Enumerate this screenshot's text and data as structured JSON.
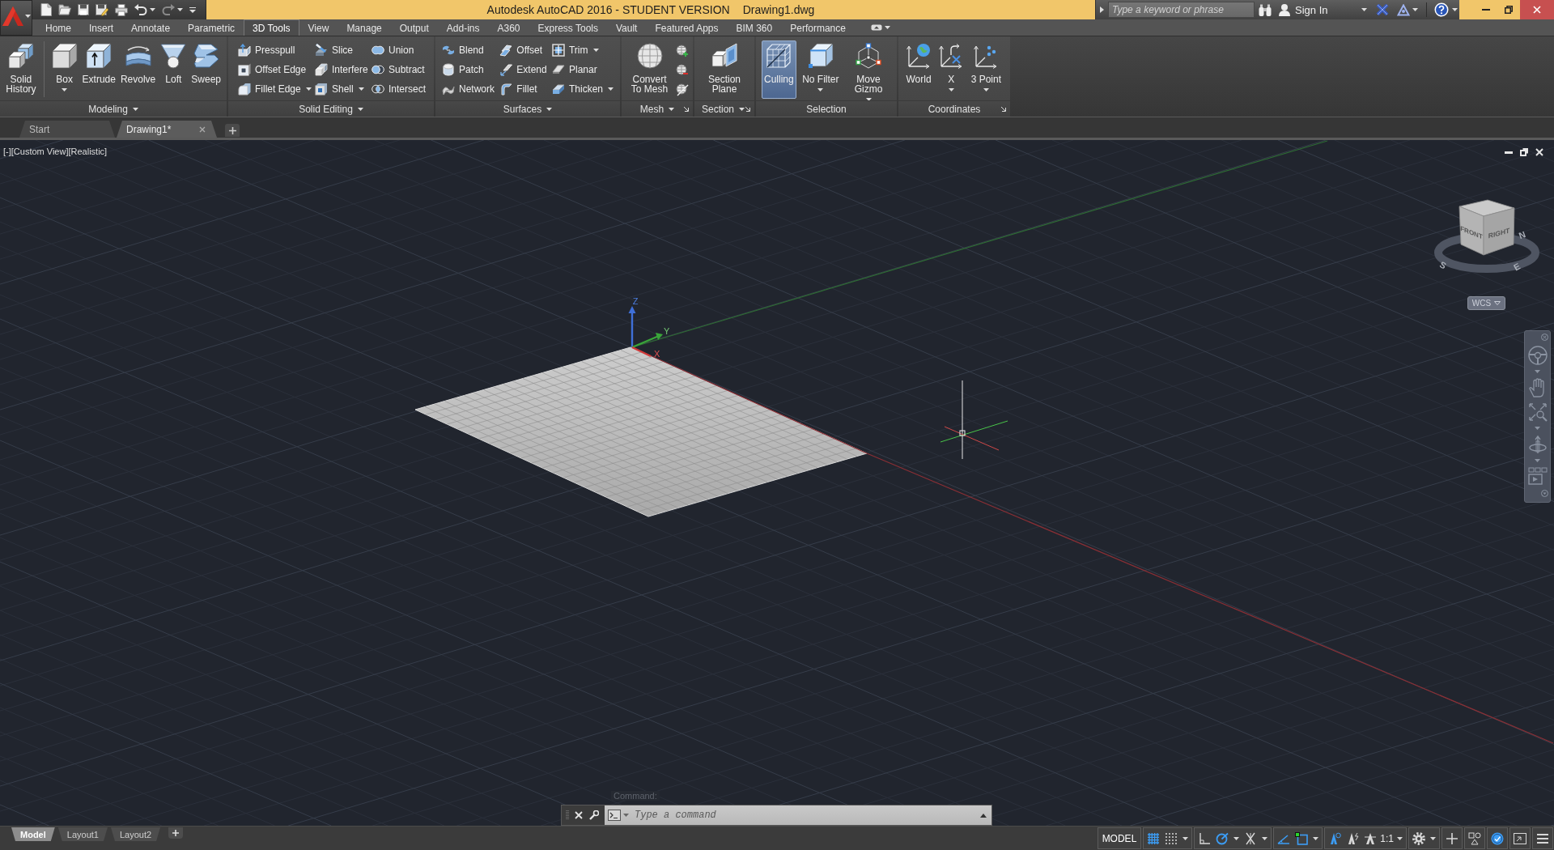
{
  "title_bar": {
    "title": "Autodesk AutoCAD 2016 - STUDENT VERSION",
    "document": "Drawing1.dwg",
    "search": {
      "placeholder": "Type a keyword or phrase"
    },
    "account": "Sign In"
  },
  "ribbon": {
    "tabs": [
      {
        "label": "Home",
        "selected": false
      },
      {
        "label": "Insert",
        "selected": false
      },
      {
        "label": "Annotate",
        "selected": false
      },
      {
        "label": "Parametric",
        "selected": false
      },
      {
        "label": "3D Tools",
        "selected": true
      },
      {
        "label": "View",
        "selected": false
      },
      {
        "label": "Manage",
        "selected": false
      },
      {
        "label": "Output",
        "selected": false
      },
      {
        "label": "Add-ins",
        "selected": false
      },
      {
        "label": "A360",
        "selected": false
      },
      {
        "label": "Express Tools",
        "selected": false
      },
      {
        "label": "Vault",
        "selected": false
      },
      {
        "label": "Featured Apps",
        "selected": false
      },
      {
        "label": "BIM 360",
        "selected": false
      },
      {
        "label": "Performance",
        "selected": false
      }
    ],
    "panels": [
      {
        "title": "Modeling",
        "expander": true,
        "launcher": false,
        "groups": [
          [
            {
              "kind": "large",
              "label": "Solid History",
              "dropdown": false
            }
          ],
          [
            {
              "kind": "large",
              "label": "Box",
              "dropdown": true
            },
            {
              "kind": "large",
              "label": "Extrude",
              "dropdown": false
            },
            {
              "kind": "large",
              "label": "Revolve",
              "dropdown": false
            },
            {
              "kind": "large",
              "label": "Loft",
              "dropdown": false
            },
            {
              "kind": "large",
              "label": "Sweep",
              "dropdown": false
            }
          ]
        ]
      },
      {
        "title": "Solid Editing",
        "expander": true,
        "launcher": false,
        "groups": [
          [
            {
              "kind": "stack",
              "tools": [
                {
                  "label": "Presspull",
                  "dropdown": false
                },
                {
                  "label": "Offset Edge",
                  "dropdown": false
                },
                {
                  "label": "Fillet Edge",
                  "dropdown": true
                }
              ]
            },
            {
              "kind": "stack",
              "tools": [
                {
                  "label": "Slice",
                  "dropdown": false
                },
                {
                  "label": "Interfere",
                  "dropdown": false
                },
                {
                  "label": "Shell",
                  "dropdown": true
                }
              ]
            },
            {
              "kind": "stack",
              "tools": [
                {
                  "label": "Union",
                  "dropdown": false
                },
                {
                  "label": "Subtract",
                  "dropdown": false
                },
                {
                  "label": "Intersect",
                  "dropdown": false
                }
              ]
            }
          ]
        ]
      },
      {
        "title": "Surfaces",
        "expander": true,
        "launcher": false,
        "groups": [
          [
            {
              "kind": "stack",
              "tools": [
                {
                  "label": "Blend",
                  "dropdown": false
                },
                {
                  "label": "Patch",
                  "dropdown": false
                },
                {
                  "label": "Network",
                  "dropdown": false
                }
              ]
            },
            {
              "kind": "stack",
              "tools": [
                {
                  "label": "Offset",
                  "dropdown": false
                },
                {
                  "label": "Extend",
                  "dropdown": false
                },
                {
                  "label": "Fillet",
                  "dropdown": false
                }
              ]
            },
            {
              "kind": "stack",
              "tools": [
                {
                  "label": "Trim",
                  "dropdown": true
                },
                {
                  "label": "Planar",
                  "dropdown": false
                },
                {
                  "label": "Thicken",
                  "dropdown": true
                }
              ]
            }
          ]
        ]
      },
      {
        "title": "Mesh",
        "expander": true,
        "launcher": true,
        "groups": [
          [
            {
              "kind": "large",
              "label": "Convert To Mesh",
              "dropdown": false
            },
            {
              "kind": "icon_stack"
            }
          ]
        ]
      },
      {
        "title": "Section",
        "expander": true,
        "launcher": true,
        "groups": [
          [
            {
              "kind": "large",
              "label": "Section Plane",
              "dropdown": false
            }
          ]
        ]
      },
      {
        "title": "Selection",
        "expander": false,
        "launcher": false,
        "groups": [
          [
            {
              "kind": "large",
              "label": "Culling",
              "dropdown": false,
              "on": true
            },
            {
              "kind": "large",
              "label": "No Filter",
              "dropdown": true,
              "on": false
            },
            {
              "kind": "large",
              "label": "Move Gizmo",
              "dropdown": true,
              "on": false
            }
          ]
        ]
      },
      {
        "title": "Coordinates",
        "expander": false,
        "launcher": true,
        "groups": [
          [
            {
              "kind": "large",
              "label": "World",
              "dropdown": false
            },
            {
              "kind": "large",
              "label": "X",
              "dropdown": true
            },
            {
              "kind": "large",
              "label": "3 Point",
              "dropdown": true
            }
          ]
        ]
      }
    ]
  },
  "file_tabs": [
    {
      "label": "Start",
      "selected": false,
      "closable": false
    },
    {
      "label": "Drawing1*",
      "selected": true,
      "closable": true
    }
  ],
  "viewport": {
    "controls": [
      "[-]",
      "[Custom View]",
      "[Realistic]"
    ],
    "ucs_axes": [
      "Z",
      "Y",
      "X"
    ],
    "view_cube": {
      "faces": [
        "FRONT",
        "RIGHT"
      ],
      "compass": [
        "S",
        "E",
        "N"
      ]
    },
    "ucs_menu": "WCS"
  },
  "command_line": {
    "history": "Command:",
    "placeholder": "Type a command"
  },
  "layout_tabs": [
    {
      "label": "Model",
      "selected": true
    },
    {
      "label": "Layout1",
      "selected": false
    },
    {
      "label": "Layout2",
      "selected": false
    }
  ],
  "status_bar": {
    "space": "MODEL",
    "toggles": [
      {
        "on": true
      },
      {
        "on": false
      },
      {
        "on": false
      },
      {
        "on": true
      },
      {
        "on": false
      },
      {
        "on": true
      },
      {
        "on": true
      },
      {
        "on": true
      },
      {
        "on": false
      },
      {
        "on": true
      }
    ],
    "annotation_scale": "1:1"
  }
}
